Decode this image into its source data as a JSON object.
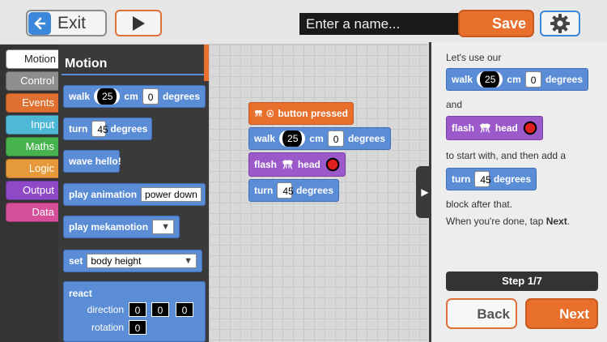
{
  "topbar": {
    "exit_label": "Exit",
    "name_placeholder": "Enter a name...",
    "save_label": "Save"
  },
  "categories": [
    {
      "label": "Motion",
      "color": "#ffffff"
    },
    {
      "label": "Control",
      "color": "#8e8e8e"
    },
    {
      "label": "Events",
      "color": "#e0702f"
    },
    {
      "label": "Input",
      "color": "#4fb8d6"
    },
    {
      "label": "Maths",
      "color": "#46b34f"
    },
    {
      "label": "Logic",
      "color": "#e6993a"
    },
    {
      "label": "Output",
      "color": "#8f48c6"
    },
    {
      "label": "Data",
      "color": "#d64f9a"
    }
  ],
  "palette": {
    "title": "Motion",
    "walk": {
      "label": "walk",
      "distance": "25",
      "unit": "cm",
      "angle": "0",
      "angle_unit": "degrees"
    },
    "turn": {
      "label": "turn",
      "angle": "45",
      "unit": "degrees"
    },
    "wave": {
      "label": "wave hello!"
    },
    "play_animation": {
      "label": "play animation",
      "value": "power down"
    },
    "play_mekamotion": {
      "label": "play mekamotion"
    },
    "set": {
      "label": "set",
      "value": "body height"
    },
    "react": {
      "label": "react",
      "direction_label": "direction",
      "direction_values": [
        "0",
        "0",
        "0"
      ],
      "rotation_label": "rotation",
      "rotation_value": "0"
    }
  },
  "workspace": {
    "event_label": "button pressed",
    "walk": {
      "label": "walk",
      "distance": "25",
      "unit": "cm",
      "angle": "0",
      "angle_unit": "degrees"
    },
    "flash": {
      "label": "flash",
      "target": "head"
    },
    "turn": {
      "label": "turn",
      "angle": "45",
      "unit": "degrees"
    }
  },
  "tutorial": {
    "intro": "Let's use our",
    "walk": {
      "label": "walk",
      "distance": "25",
      "unit": "cm",
      "angle": "0",
      "angle_unit": "degrees"
    },
    "and": "and",
    "flash": {
      "label": "flash",
      "target": "head"
    },
    "start_text": "to start with, and then add a",
    "turn": {
      "label": "turn",
      "angle": "45",
      "unit": "degrees"
    },
    "after_text": "block after that.",
    "done_prefix": "When you're done, tap ",
    "done_emphasis": "Next",
    "done_suffix": ".",
    "step": "Step 1/7",
    "back_label": "Back",
    "next_label": "Next"
  },
  "colors": {
    "motion_block": "#5b8dd6",
    "output_block": "#9b59c9",
    "event_block": "#e86f2c",
    "accent": "#e86f2c",
    "led": "#e02020"
  },
  "icons": [
    "back-arrow-icon",
    "play-icon",
    "gear-icon",
    "robot-icon",
    "button-icon",
    "led-icon",
    "expand-icon"
  ]
}
